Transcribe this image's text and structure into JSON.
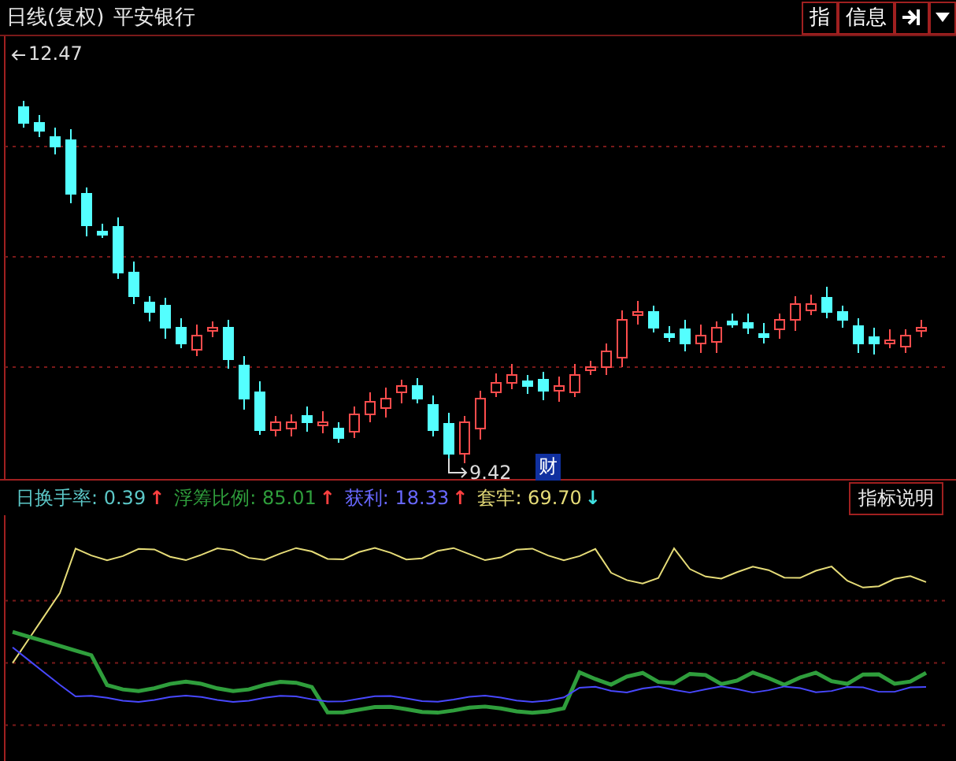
{
  "header": {
    "period": "日线(复权)",
    "stock_name": "平安银行",
    "buttons": [
      {
        "label": "指"
      },
      {
        "label": "信息"
      }
    ]
  },
  "price_chart": {
    "high_label": "12.47",
    "low_label": "9.42",
    "event_badge": "财"
  },
  "indicator": {
    "readings": [
      {
        "label": "日换手率:",
        "value": "0.39",
        "color": "#5cc8c8",
        "arrow": {
          "text": "↑",
          "color": "#ff4040"
        }
      },
      {
        "label": "浮筹比例:",
        "value": "85.01",
        "color": "#2f9e3c",
        "arrow": {
          "text": "↑",
          "color": "#ff4040"
        }
      },
      {
        "label": "获利:",
        "value": "18.33",
        "color": "#6868ff",
        "arrow": {
          "text": "↑",
          "color": "#ff4040"
        }
      },
      {
        "label": "套牢:",
        "value": "69.70",
        "color": "#e6dc78",
        "arrow": {
          "text": "↓",
          "color": "#40e0e0"
        }
      }
    ],
    "help_button": "指标说明"
  }
}
